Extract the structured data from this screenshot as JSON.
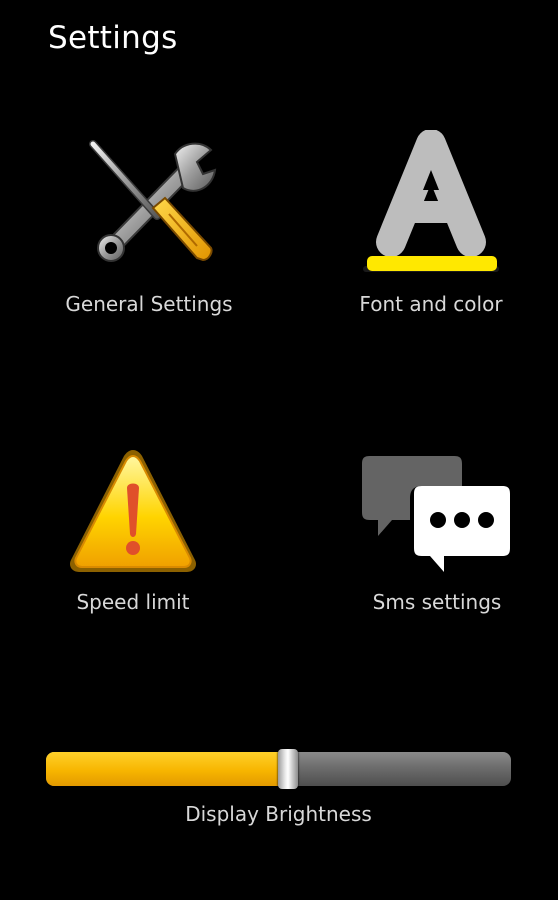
{
  "header": {
    "title": "Settings"
  },
  "tiles": {
    "general": {
      "label": "General Settings",
      "icon": "tools-icon"
    },
    "font": {
      "label": "Font and color",
      "icon": "font-a-icon"
    },
    "speed": {
      "label": "Speed limit",
      "icon": "warning-icon"
    },
    "sms": {
      "label": "Sms settings",
      "icon": "chat-bubbles-icon"
    }
  },
  "brightness": {
    "label": "Display Brightness",
    "value_percent": 52
  },
  "colors": {
    "background": "#000000",
    "accent": "#f7b500",
    "text": "#d8d8d8"
  }
}
